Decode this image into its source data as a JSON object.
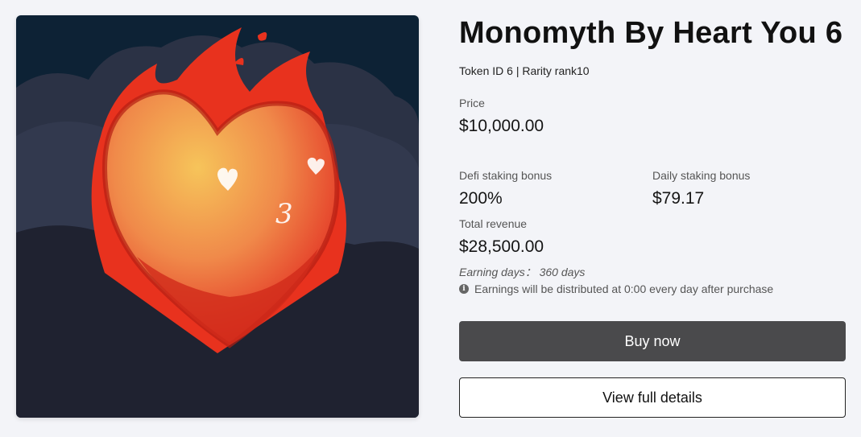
{
  "product": {
    "title": "Monomyth By Heart You 6",
    "meta": "Token ID 6 | Rarity rank10",
    "image_alt": "flaming-heart-nft-art"
  },
  "price": {
    "label": "Price",
    "value": "$10,000.00"
  },
  "defi": {
    "label": "Defi staking bonus",
    "value": "200%"
  },
  "daily": {
    "label": "Daily staking bonus",
    "value": "$79.17"
  },
  "total": {
    "label": "Total revenue",
    "value": "$28,500.00"
  },
  "earning_days": "Earning days： 360 days",
  "notice": {
    "icon": "info-icon",
    "text": "Earnings will be distributed at 0:00 every day after purchase"
  },
  "actions": {
    "buy_label": "Buy now",
    "details_label": "View full details"
  },
  "colors": {
    "page_bg": "#f3f4f8",
    "buy_button": "#4a4a4c",
    "art_sky": "#0d2235",
    "art_ground": "#1f2230",
    "flame_red": "#e8321e"
  }
}
